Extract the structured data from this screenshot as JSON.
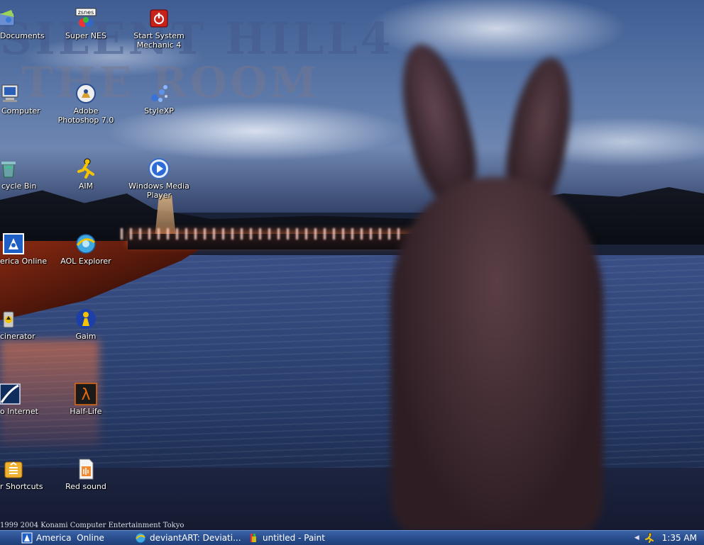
{
  "wallpaper": {
    "title_line1": "SILENT HILL4",
    "title_line2": "THE ROOM",
    "copyright": "1999 2004 Konami Computer Entertainment Tokyo"
  },
  "icons": [
    {
      "id": "documents",
      "label": "Documents",
      "icon": "documents-icon"
    },
    {
      "id": "super-nes",
      "label": "Super NES",
      "icon": "zsnes-icon",
      "badge": "zsnes"
    },
    {
      "id": "system-mechanic",
      "label": "Start System Mechanic 4",
      "icon": "power-icon"
    },
    {
      "id": "computer",
      "label": "Computer",
      "icon": "computer-icon"
    },
    {
      "id": "photoshop",
      "label": "Adobe Photoshop 7.0",
      "icon": "photoshop-icon"
    },
    {
      "id": "stylexp",
      "label": "StyleXP",
      "icon": "stylexp-icon"
    },
    {
      "id": "recycle-bin",
      "label": "cycle Bin",
      "icon": "recycle-bin-icon"
    },
    {
      "id": "aim",
      "label": "AIM",
      "icon": "aim-icon"
    },
    {
      "id": "wmp",
      "label": "Windows Media Player",
      "icon": "media-player-icon"
    },
    {
      "id": "america-online",
      "label": "erica Online",
      "icon": "aol-icon"
    },
    {
      "id": "aol-explorer",
      "label": "AOL Explorer",
      "icon": "aol-explorer-icon"
    },
    {
      "id": "incinerator",
      "label": "cinerator",
      "icon": "incinerator-icon"
    },
    {
      "id": "gaim",
      "label": "Gaim",
      "icon": "gaim-icon"
    },
    {
      "id": "internet",
      "label": "o Internet",
      "icon": "internet-icon"
    },
    {
      "id": "half-life",
      "label": "Half-Life",
      "icon": "half-life-icon"
    },
    {
      "id": "shortcuts",
      "label": "r Shortcuts",
      "icon": "shortcuts-icon"
    },
    {
      "id": "red-sound",
      "label": "Red sound",
      "icon": "sound-file-icon"
    }
  ],
  "taskbar": {
    "buttons": [
      {
        "label": "America  Online",
        "icon": "aol-icon"
      },
      {
        "label": "deviantART: Deviati...",
        "icon": "aol-explorer-icon"
      },
      {
        "label": "untitled - Paint",
        "icon": "paint-icon"
      }
    ],
    "tray": {
      "clock": "1:35 AM",
      "aim_icon": "aim-icon",
      "arrow_icon": "chevron-left-icon"
    }
  },
  "colors": {
    "taskbar": "#2a4e8e",
    "icon_label": "#ffffff"
  }
}
